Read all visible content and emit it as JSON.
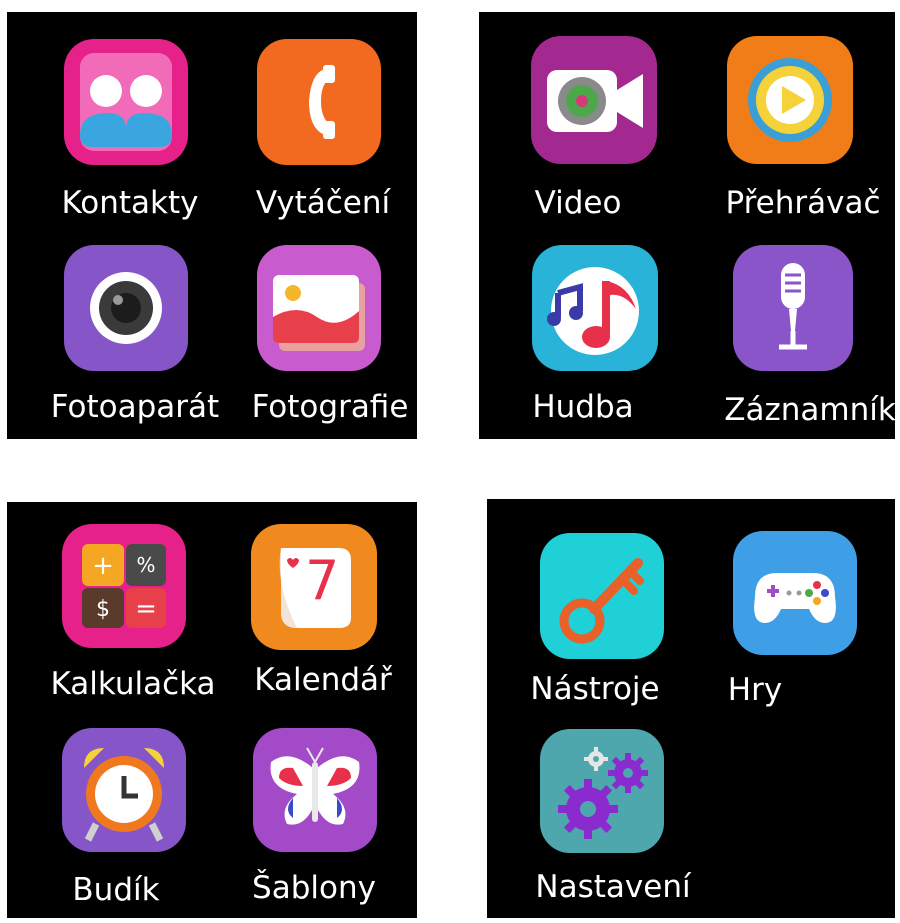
{
  "screens": [
    {
      "apps": [
        {
          "label": "Kontakty",
          "icon": "contacts-icon",
          "color": "#e6218a"
        },
        {
          "label": "Vytáčení",
          "icon": "phone-icon",
          "color": "#f26a1f"
        },
        {
          "label": "Fotoaparát",
          "icon": "camera-icon",
          "color": "#8656c9"
        },
        {
          "label": "Fotografie",
          "icon": "gallery-icon",
          "color": "#c85ccf"
        }
      ]
    },
    {
      "apps": [
        {
          "label": "Video",
          "icon": "video-camera-icon",
          "color": "#a3288f"
        },
        {
          "label": "Přehrávač",
          "icon": "play-icon",
          "color": "#f07d17"
        },
        {
          "label": "Hudba",
          "icon": "music-note-icon",
          "color": "#29b3d9"
        },
        {
          "label": "Záznamník",
          "icon": "microphone-icon",
          "color": "#8a55c8"
        }
      ]
    },
    {
      "apps": [
        {
          "label": "Kalkulačka",
          "icon": "calculator-icon",
          "color": "#e6218a"
        },
        {
          "label": "Kalendář",
          "icon": "calendar-icon",
          "color": "#f08a1e"
        },
        {
          "label": "Budík",
          "icon": "alarm-clock-icon",
          "color": "#8656c9"
        },
        {
          "label": "Šablony",
          "icon": "butterfly-icon",
          "color": "#a34ac9"
        }
      ]
    },
    {
      "apps": [
        {
          "label": "Nástroje",
          "icon": "key-icon",
          "color": "#1fd0d6"
        },
        {
          "label": "Hry",
          "icon": "gamepad-icon",
          "color": "#3f9fe6"
        },
        {
          "label": "Nastavení",
          "icon": "gears-icon",
          "color": "#4fa7ae"
        }
      ]
    }
  ],
  "calendar_day": "7"
}
